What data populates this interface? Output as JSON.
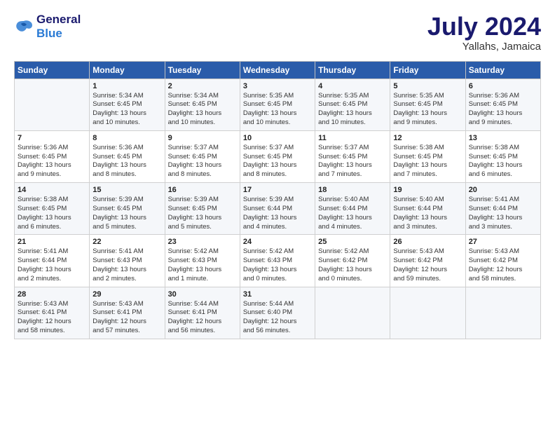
{
  "logo": {
    "line1": "General",
    "line2": "Blue"
  },
  "title": "July 2024",
  "subtitle": "Yallahs, Jamaica",
  "days": [
    "Sunday",
    "Monday",
    "Tuesday",
    "Wednesday",
    "Thursday",
    "Friday",
    "Saturday"
  ],
  "weeks": [
    [
      {
        "day": "",
        "info": ""
      },
      {
        "day": "1",
        "info": "Sunrise: 5:34 AM\nSunset: 6:45 PM\nDaylight: 13 hours\nand 10 minutes."
      },
      {
        "day": "2",
        "info": "Sunrise: 5:34 AM\nSunset: 6:45 PM\nDaylight: 13 hours\nand 10 minutes."
      },
      {
        "day": "3",
        "info": "Sunrise: 5:35 AM\nSunset: 6:45 PM\nDaylight: 13 hours\nand 10 minutes."
      },
      {
        "day": "4",
        "info": "Sunrise: 5:35 AM\nSunset: 6:45 PM\nDaylight: 13 hours\nand 10 minutes."
      },
      {
        "day": "5",
        "info": "Sunrise: 5:35 AM\nSunset: 6:45 PM\nDaylight: 13 hours\nand 9 minutes."
      },
      {
        "day": "6",
        "info": "Sunrise: 5:36 AM\nSunset: 6:45 PM\nDaylight: 13 hours\nand 9 minutes."
      }
    ],
    [
      {
        "day": "7",
        "info": "Sunrise: 5:36 AM\nSunset: 6:45 PM\nDaylight: 13 hours\nand 9 minutes."
      },
      {
        "day": "8",
        "info": "Sunrise: 5:36 AM\nSunset: 6:45 PM\nDaylight: 13 hours\nand 8 minutes."
      },
      {
        "day": "9",
        "info": "Sunrise: 5:37 AM\nSunset: 6:45 PM\nDaylight: 13 hours\nand 8 minutes."
      },
      {
        "day": "10",
        "info": "Sunrise: 5:37 AM\nSunset: 6:45 PM\nDaylight: 13 hours\nand 8 minutes."
      },
      {
        "day": "11",
        "info": "Sunrise: 5:37 AM\nSunset: 6:45 PM\nDaylight: 13 hours\nand 7 minutes."
      },
      {
        "day": "12",
        "info": "Sunrise: 5:38 AM\nSunset: 6:45 PM\nDaylight: 13 hours\nand 7 minutes."
      },
      {
        "day": "13",
        "info": "Sunrise: 5:38 AM\nSunset: 6:45 PM\nDaylight: 13 hours\nand 6 minutes."
      }
    ],
    [
      {
        "day": "14",
        "info": "Sunrise: 5:38 AM\nSunset: 6:45 PM\nDaylight: 13 hours\nand 6 minutes."
      },
      {
        "day": "15",
        "info": "Sunrise: 5:39 AM\nSunset: 6:45 PM\nDaylight: 13 hours\nand 5 minutes."
      },
      {
        "day": "16",
        "info": "Sunrise: 5:39 AM\nSunset: 6:45 PM\nDaylight: 13 hours\nand 5 minutes."
      },
      {
        "day": "17",
        "info": "Sunrise: 5:39 AM\nSunset: 6:44 PM\nDaylight: 13 hours\nand 4 minutes."
      },
      {
        "day": "18",
        "info": "Sunrise: 5:40 AM\nSunset: 6:44 PM\nDaylight: 13 hours\nand 4 minutes."
      },
      {
        "day": "19",
        "info": "Sunrise: 5:40 AM\nSunset: 6:44 PM\nDaylight: 13 hours\nand 3 minutes."
      },
      {
        "day": "20",
        "info": "Sunrise: 5:41 AM\nSunset: 6:44 PM\nDaylight: 13 hours\nand 3 minutes."
      }
    ],
    [
      {
        "day": "21",
        "info": "Sunrise: 5:41 AM\nSunset: 6:44 PM\nDaylight: 13 hours\nand 2 minutes."
      },
      {
        "day": "22",
        "info": "Sunrise: 5:41 AM\nSunset: 6:43 PM\nDaylight: 13 hours\nand 2 minutes."
      },
      {
        "day": "23",
        "info": "Sunrise: 5:42 AM\nSunset: 6:43 PM\nDaylight: 13 hours\nand 1 minute."
      },
      {
        "day": "24",
        "info": "Sunrise: 5:42 AM\nSunset: 6:43 PM\nDaylight: 13 hours\nand 0 minutes."
      },
      {
        "day": "25",
        "info": "Sunrise: 5:42 AM\nSunset: 6:42 PM\nDaylight: 13 hours\nand 0 minutes."
      },
      {
        "day": "26",
        "info": "Sunrise: 5:43 AM\nSunset: 6:42 PM\nDaylight: 12 hours\nand 59 minutes."
      },
      {
        "day": "27",
        "info": "Sunrise: 5:43 AM\nSunset: 6:42 PM\nDaylight: 12 hours\nand 58 minutes."
      }
    ],
    [
      {
        "day": "28",
        "info": "Sunrise: 5:43 AM\nSunset: 6:41 PM\nDaylight: 12 hours\nand 58 minutes."
      },
      {
        "day": "29",
        "info": "Sunrise: 5:43 AM\nSunset: 6:41 PM\nDaylight: 12 hours\nand 57 minutes."
      },
      {
        "day": "30",
        "info": "Sunrise: 5:44 AM\nSunset: 6:41 PM\nDaylight: 12 hours\nand 56 minutes."
      },
      {
        "day": "31",
        "info": "Sunrise: 5:44 AM\nSunset: 6:40 PM\nDaylight: 12 hours\nand 56 minutes."
      },
      {
        "day": "",
        "info": ""
      },
      {
        "day": "",
        "info": ""
      },
      {
        "day": "",
        "info": ""
      }
    ]
  ]
}
